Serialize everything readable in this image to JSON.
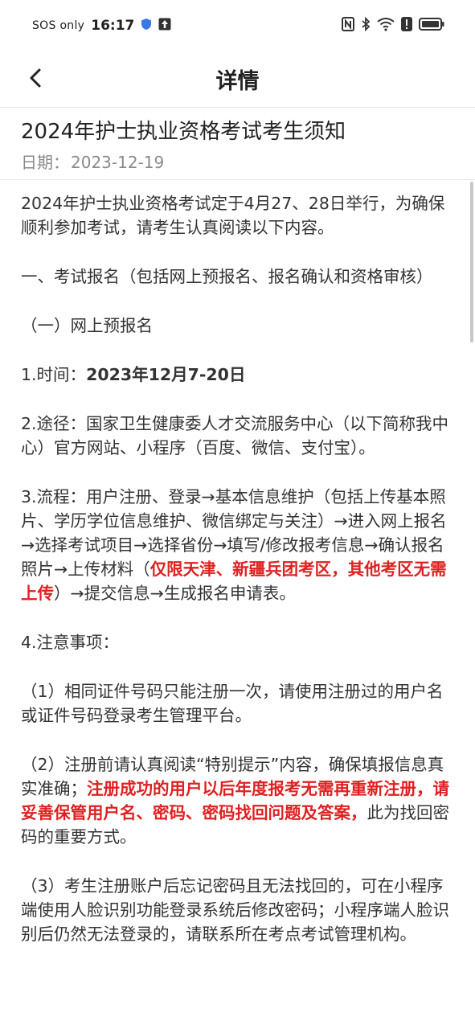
{
  "status_bar": {
    "carrier": "SOS only",
    "time": "16:17",
    "icons": [
      "shield-icon",
      "upload-arrow-icon",
      "nfc-icon",
      "bluetooth-icon",
      "wifi-icon",
      "alert-icon",
      "battery-icon"
    ]
  },
  "nav": {
    "back_icon": "chevron-left-icon",
    "title": "详情"
  },
  "article": {
    "title": "2024年护士执业资格考试考生须知",
    "date_label": "日期：",
    "date": "2023-12-19"
  },
  "content": {
    "intro": "2024年护士执业资格考试定于4月27、28日举行，为确保顺利参加考试，请考生认真阅读以下内容。",
    "section1": "一、考试报名（包括网上预报名、报名确认和资格审核）",
    "sub1": "（一）网上预报名",
    "time_label": "1.时间：",
    "time_value": "2023年12月7-20日",
    "route": "2.途径：国家卫生健康委人才交流服务中心（以下简称我中心）官方网站、小程序（百度、微信、支付宝）。",
    "process_a": "3.流程：用户注册、登录→基本信息维护（包括上传基本照片、学历学位信息维护、微信绑定与关注）→进入网上报名→选择考试项目→选择省份→填写/修改报考信息→确认报名照片→上传材料（",
    "process_red": "仅限天津、新疆兵团考区，其他考区无需上传",
    "process_b": "）→提交信息→生成报名申请表。",
    "notes_heading": "4.注意事项：",
    "note1": "（1）相同证件号码只能注册一次，请使用注册过的用户名或证件号码登录考生管理平台。",
    "note2_a": "（2）注册前请认真阅读“特别提示”内容，确保填报信息真实准确；",
    "note2_red": "注册成功的用户以后年度报考无需再重新注册，请妥善保管用户名、密码、密码找回问题及答案，",
    "note2_b": "此为找回密码的重要方式。",
    "note3": "（3）考生注册账户后忘记密码且无法找回的，可在小程序端使用人脸识别功能登录系统后修改密码；小程序端人脸识别后仍然无法登录的，请联系所在考点考试管理机构。"
  },
  "colors": {
    "highlight_red": "#e02020",
    "divider": "#e6e6e6"
  }
}
